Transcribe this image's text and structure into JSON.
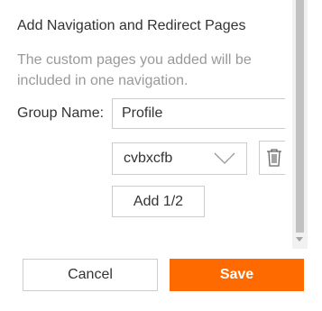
{
  "dialog": {
    "title": "Add Navigation and Redirect Pages",
    "description": "The custom pages you added will be included in one navigation.",
    "group_name_label": "Group Name:",
    "group_name_value": "Profile",
    "page_select_value": "cvbxcfb",
    "add_button_label": "Add 1/2"
  },
  "footer": {
    "cancel_label": "Cancel",
    "save_label": "Save"
  },
  "icons": {
    "select_arrow": "chevron-down-icon",
    "delete": "trash-icon",
    "scroll_down": "scroll-down-arrow-icon"
  },
  "colors": {
    "accent": "#ff6a00",
    "border": "#cccccc",
    "muted_text": "#999999",
    "text": "#333333"
  }
}
